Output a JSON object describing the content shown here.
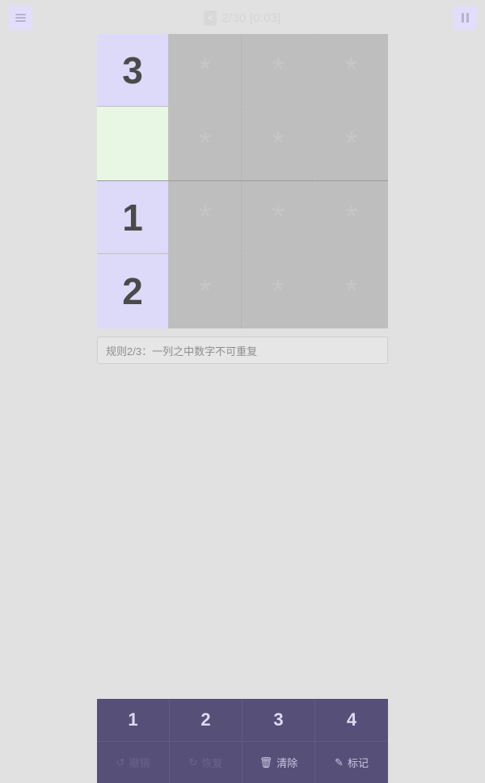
{
  "header": {
    "menu_icon": "hamburger-icon",
    "back_label": "<",
    "progress": "2/30 [0:03]",
    "pause_icon": "pause-icon"
  },
  "board": {
    "size": 4,
    "masked_glyph": "*",
    "colors": {
      "given_bg": "#ddd9f9",
      "masked_bg": "#bebebe",
      "selected_bg": "#e8f7e4",
      "digit": "#4a4a4a"
    },
    "cells": [
      {
        "value": "3",
        "state": "given"
      },
      {
        "value": "*",
        "state": "masked"
      },
      {
        "value": "*",
        "state": "masked"
      },
      {
        "value": "*",
        "state": "masked"
      },
      {
        "value": "",
        "state": "selected"
      },
      {
        "value": "*",
        "state": "masked"
      },
      {
        "value": "*",
        "state": "masked"
      },
      {
        "value": "*",
        "state": "masked"
      },
      {
        "value": "1",
        "state": "given"
      },
      {
        "value": "*",
        "state": "masked"
      },
      {
        "value": "*",
        "state": "masked"
      },
      {
        "value": "*",
        "state": "masked"
      },
      {
        "value": "2",
        "state": "given"
      },
      {
        "value": "*",
        "state": "masked"
      },
      {
        "value": "*",
        "state": "masked"
      },
      {
        "value": "*",
        "state": "masked"
      }
    ]
  },
  "rule": {
    "text": "规则2/3：一列之中数字不可重复"
  },
  "numpad": {
    "accent": "#564f77",
    "numbers": [
      "1",
      "2",
      "3",
      "4"
    ],
    "actions": [
      {
        "label": "撤销",
        "icon": "undo-icon",
        "disabled": true
      },
      {
        "label": "恢复",
        "icon": "redo-icon",
        "disabled": true
      },
      {
        "label": "清除",
        "icon": "trash-icon",
        "disabled": false
      },
      {
        "label": "标记",
        "icon": "pencil-icon",
        "disabled": false
      }
    ]
  }
}
